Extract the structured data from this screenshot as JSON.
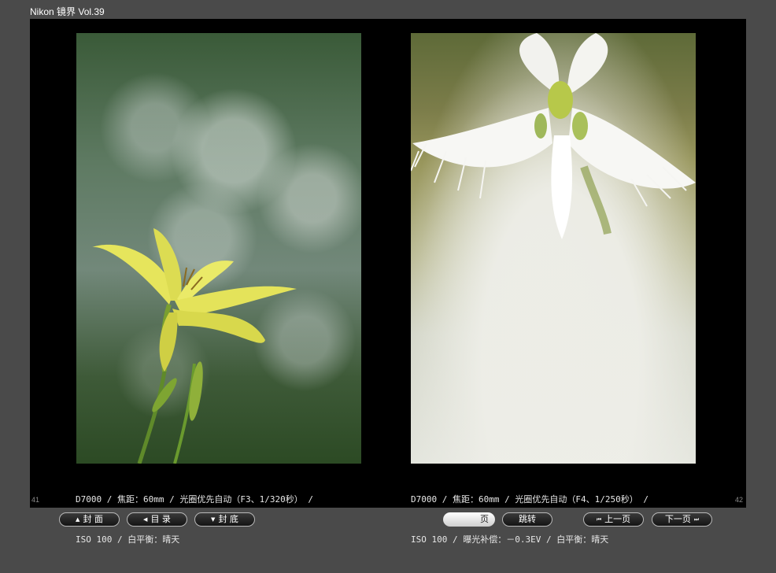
{
  "app": {
    "title": "Nikon 镜界 Vol.39"
  },
  "pages": {
    "left": {
      "number": "41",
      "caption_line1": "D7000 / 焦距：60mm / 光圈优先自动（F3、1/320秒） /",
      "caption_line2": "ISO 100 / 白平衡：晴天"
    },
    "right": {
      "number": "42",
      "caption_line1": "D7000 / 焦距：60mm / 光圈优先自动（F4、1/250秒） /",
      "caption_line2": "ISO 100 / 曝光补偿：－0.3EV / 白平衡：晴天"
    }
  },
  "nav": {
    "cover": {
      "icon": "▲",
      "label": "封 面"
    },
    "toc": {
      "icon": "◀",
      "label": "目 录"
    },
    "back_cover": {
      "icon": "▼",
      "label": "封 底"
    },
    "page_input": {
      "value": "",
      "suffix": "页"
    },
    "jump_label": "跳转",
    "prev": {
      "icon": "⏮",
      "label": "上一页"
    },
    "next": {
      "icon": "⏭",
      "label": "下一页"
    }
  }
}
